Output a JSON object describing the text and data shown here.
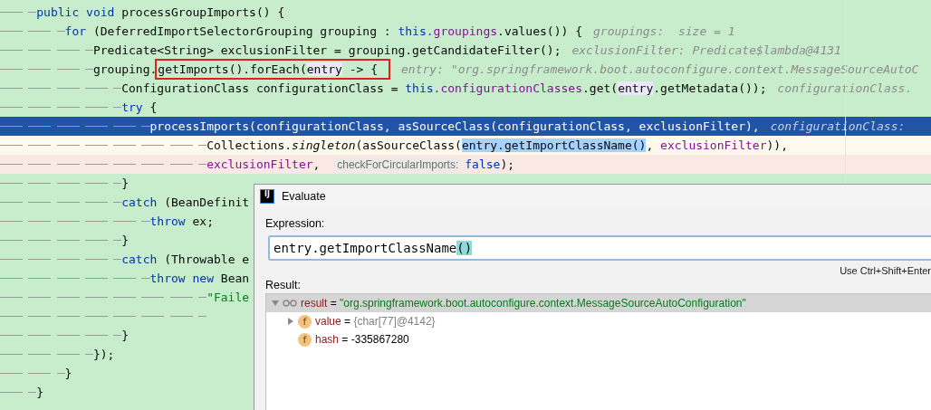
{
  "editor": {
    "lines": [
      {
        "tokens": [
          {
            "text": "public void",
            "kind": "keyword"
          },
          {
            "text": " processGroupImports() {",
            "kind": "plain"
          }
        ],
        "children": [
          {
            "tokens": [
              {
                "text": "for",
                "kind": "keyword"
              },
              {
                "text": " (DeferredImportSelectorGrouping grouping : ",
                "kind": "plain"
              },
              {
                "text": "this",
                "kind": "keyword"
              },
              {
                "text": ".groupings",
                "kind": "field"
              },
              {
                "text": ".values()) {",
                "kind": "plain"
              },
              {
                "text": "groupings:  size = 1",
                "kind": "hint"
              }
            ],
            "children": [
              {
                "tokens": [
                  {
                    "text": "Predicate<String> exclusionFilter = grouping.getCandidateFilter();",
                    "kind": "plain"
                  },
                  {
                    "text": "exclusionFilter: Predicate$lambda@4131",
                    "kind": "hint"
                  }
                ]
              },
              {
                "tokens": [
                  {
                    "text": "grouping.",
                    "kind": "plain"
                  },
                  {
                    "kind": "boxed",
                    "tokens": [
                      {
                        "text": "getImports().forEach(",
                        "kind": "plain"
                      },
                      {
                        "text": "entry",
                        "kind": "usage"
                      },
                      {
                        "text": " -> {",
                        "kind": "plain"
                      }
                    ]
                  },
                  {
                    "text": "entry: \"org.springframework.boot.autoconfigure.context.MessageSourceAutoC",
                    "kind": "hint"
                  }
                ],
                "children": [
                  {
                    "tokens": [
                      {
                        "text": "ConfigurationClass configurationClass = ",
                        "kind": "plain"
                      },
                      {
                        "text": "this",
                        "kind": "keyword"
                      },
                      {
                        "text": ".configurationClasses",
                        "kind": "field"
                      },
                      {
                        "text": ".get(",
                        "kind": "plain"
                      },
                      {
                        "text": "entry",
                        "kind": "usage"
                      },
                      {
                        "text": ".getMetadata());",
                        "kind": "plain"
                      },
                      {
                        "text": "configurationClass.",
                        "kind": "hint"
                      }
                    ]
                  },
                  {
                    "tokens": [
                      {
                        "text": "try",
                        "kind": "keyword"
                      },
                      {
                        "text": " {",
                        "kind": "plain"
                      }
                    ],
                    "children": [
                      {
                        "execution_point": true,
                        "tokens": [
                          {
                            "text": "processImports(configurationClass, asSourceClass(configurationClass, exclusionFilter),",
                            "kind": "plain"
                          },
                          {
                            "text": "configurationClass:",
                            "kind": "hint"
                          }
                        ],
                        "children": [
                          {
                            "kind": "continuation",
                            "caret_line": true,
                            "tokens": [
                              {
                                "text": "Collections.",
                                "kind": "plain"
                              },
                              {
                                "text": "singleton",
                                "kind": "static"
                              },
                              {
                                "text": "(asSourceClass(",
                                "kind": "plain"
                              },
                              {
                                "text": "entry.getImportClassName()",
                                "kind": "selection"
                              },
                              {
                                "text": ", ",
                                "kind": "plain"
                              },
                              {
                                "text": "exclusionFilter",
                                "kind": "field"
                              },
                              {
                                "text": ")),",
                                "kind": "plain"
                              }
                            ]
                          },
                          {
                            "kind": "continuation",
                            "breakpoint": true,
                            "tokens": [
                              {
                                "text": "exclusionFilter",
                                "kind": "field"
                              },
                              {
                                "text": ", ",
                                "kind": "plain"
                              },
                              {
                                "text": "checkForCircularImports:",
                                "kind": "param-hint"
                              },
                              {
                                "text": "false",
                                "kind": "keyword"
                              },
                              {
                                "text": ");",
                                "kind": "plain"
                              }
                            ]
                          }
                        ]
                      }
                    ]
                  },
                  {
                    "tokens": [
                      {
                        "text": "}",
                        "kind": "plain"
                      }
                    ]
                  },
                  {
                    "tokens": [
                      {
                        "text": "catch",
                        "kind": "keyword"
                      },
                      {
                        "text": " (BeanDefinit",
                        "kind": "plain"
                      }
                    ],
                    "children": [
                      {
                        "tokens": [
                          {
                            "text": "throw",
                            "kind": "keyword"
                          },
                          {
                            "text": " ex;",
                            "kind": "plain"
                          }
                        ]
                      }
                    ]
                  },
                  {
                    "tokens": [
                      {
                        "text": "}",
                        "kind": "plain"
                      }
                    ]
                  },
                  {
                    "tokens": [
                      {
                        "text": "catch",
                        "kind": "keyword"
                      },
                      {
                        "text": " (Throwable e",
                        "kind": "plain"
                      }
                    ],
                    "children": [
                      {
                        "tokens": [
                          {
                            "text": "throw new",
                            "kind": "keyword"
                          },
                          {
                            "text": " Bean",
                            "kind": "plain"
                          }
                        ],
                        "children": [
                          {
                            "kind": "continuation",
                            "tokens": [
                              {
                                "text": "\"Faile",
                                "kind": "string"
                              }
                            ]
                          },
                          {
                            "kind": "continuation"
                          }
                        ]
                      }
                    ]
                  },
                  {
                    "tokens": [
                      {
                        "text": "}",
                        "kind": "plain"
                      }
                    ]
                  }
                ]
              },
              {
                "tokens": [
                  {
                    "text": "});",
                    "kind": "plain"
                  }
                ]
              }
            ]
          },
          {
            "tokens": [
              {
                "text": "}",
                "kind": "plain"
              }
            ]
          }
        ]
      },
      {
        "tokens": [
          {
            "text": "}",
            "kind": "plain"
          }
        ]
      }
    ]
  },
  "dialog": {
    "logo": "IJ",
    "title": "Evaluate",
    "expression_label": "Expression:",
    "expression": [
      {
        "text": "entry.getImportClassName",
        "kind": "plain"
      },
      {
        "text": "()",
        "kind": "brace-match"
      }
    ],
    "shortcut_hint": "Use Ctrl+Shift+Enter",
    "result_label": "Result:",
    "result_tree": [
      {
        "kind": "watch",
        "expanded": true,
        "selected": true,
        "parts": [
          {
            "text": "result",
            "kind": "name"
          },
          {
            "text": " = ",
            "kind": "plain"
          },
          {
            "text": "\"org.springframework.boot.autoconfigure.context.MessageSourceAutoConfiguration\"",
            "kind": "string"
          }
        ],
        "children": [
          {
            "kind": "field",
            "badge": "f",
            "expanded": false,
            "selected": false,
            "parts": [
              {
                "text": "value",
                "kind": "name"
              },
              {
                "text": " = ",
                "kind": "plain"
              },
              {
                "text": "{char[77]@4142}",
                "kind": "ref"
              }
            ]
          },
          {
            "kind": "field",
            "badge": "f",
            "selected": false,
            "parts": [
              {
                "text": "hash",
                "kind": "name"
              },
              {
                "text": " = ",
                "kind": "plain"
              },
              {
                "text": "-335867280",
                "kind": "plain"
              }
            ]
          }
        ]
      }
    ]
  }
}
